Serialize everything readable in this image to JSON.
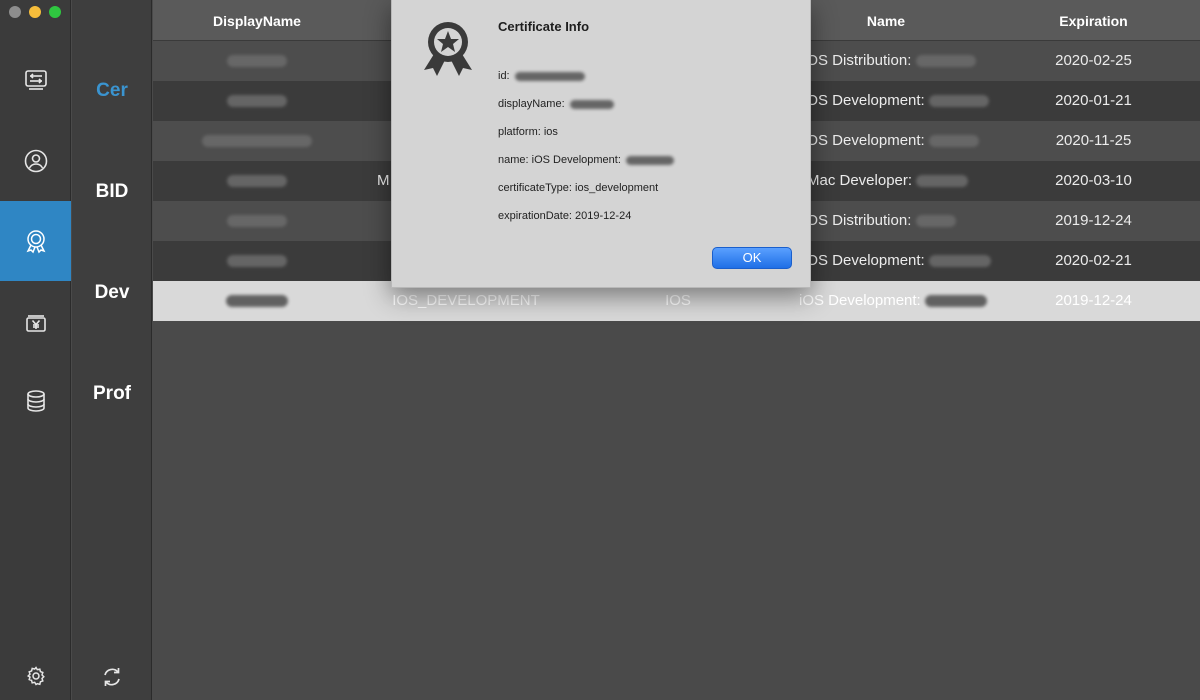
{
  "window": {
    "traffic_colors": [
      "#8d8d8d",
      "#f6bd3b",
      "#2fc740"
    ]
  },
  "rail": {
    "items": [
      {
        "icon": "list-sliders-icon",
        "active": false
      },
      {
        "icon": "user-circle-icon",
        "active": false
      },
      {
        "icon": "certificate-badge-icon",
        "active": true
      },
      {
        "icon": "yen-box-icon",
        "active": false
      },
      {
        "icon": "database-icon",
        "active": false
      }
    ],
    "settings_icon": "gear-icon",
    "accent": "#2f86c4"
  },
  "subnav": {
    "items": [
      "Cer",
      "BID",
      "Dev",
      "Prof"
    ],
    "active_index": 0,
    "refresh_icon": "refresh-icon"
  },
  "table": {
    "headers": [
      "DisplayName",
      "",
      "",
      "Name",
      "Expiration"
    ],
    "rows": [
      {
        "display_name": "",
        "type": "",
        "platform": "",
        "name": "iOS Distribution: ",
        "expiration": "2020-02-25"
      },
      {
        "display_name": "",
        "type": "",
        "platform": "",
        "name": "iOS Development: ",
        "expiration": "2020-01-21"
      },
      {
        "display_name": "",
        "type": "",
        "platform": "",
        "name": "iOS Development: ",
        "expiration": "2020-11-25"
      },
      {
        "display_name": "",
        "type": "M",
        "platform": "",
        "name": "Mac Developer: ",
        "expiration": "2020-03-10"
      },
      {
        "display_name": "",
        "type": "",
        "platform": "",
        "name": "iOS Distribution: ",
        "expiration": "2019-12-24"
      },
      {
        "display_name": "",
        "type": "",
        "platform": "",
        "name": "iOS Development: ",
        "expiration": "2020-02-21"
      },
      {
        "display_name": "",
        "type": "IOS_DEVELOPMENT",
        "platform": "IOS",
        "name": "iOS Development: ",
        "expiration": "2019-12-24"
      }
    ],
    "selected_index": 6
  },
  "dialog": {
    "title": "Certificate Info",
    "icon": "certificate-award-icon",
    "fields": {
      "id": "id: ",
      "display_name": "displayName: ",
      "platform": "platform: ios",
      "name": "name: iOS Development: ",
      "certificate_type": "certificateType: ios_development",
      "expiration_date": "expirationDate: 2019-12-24"
    },
    "ok_label": "OK"
  }
}
